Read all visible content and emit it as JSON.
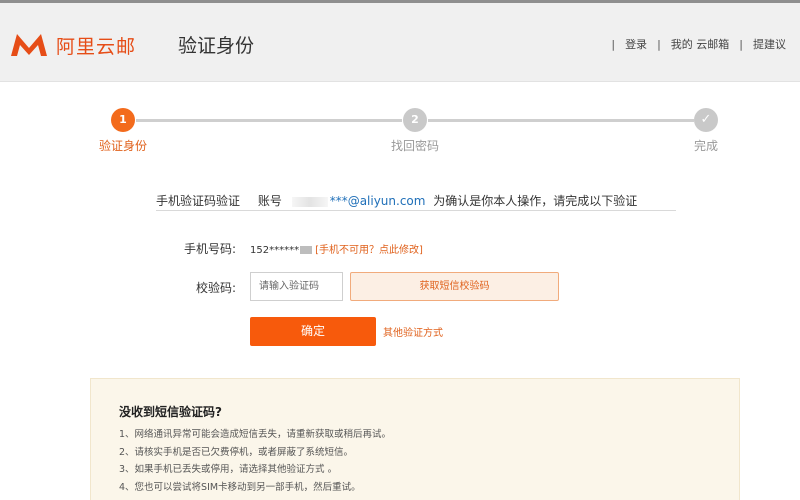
{
  "header": {
    "logo_text": "阿里云邮",
    "page_title": "验证身份",
    "nav": [
      {
        "label": "登录"
      },
      {
        "label": "我的 云邮箱"
      },
      {
        "label": "提建议"
      }
    ]
  },
  "steps": [
    {
      "number": "1",
      "label": "验证身份",
      "state": "active"
    },
    {
      "number": "2",
      "label": "找回密码",
      "state": "pending"
    },
    {
      "number": "✓",
      "label": "完成",
      "state": "pending"
    }
  ],
  "info": {
    "method_label": "手机验证码验证",
    "account_prefix": "账号",
    "account_email": "***@aliyun.com",
    "instruction": "为确认是你本人操作，请完成以下验证"
  },
  "form": {
    "phone_label": "手机号码:",
    "phone_value": "152******",
    "phone_change_link": "[手机不可用？点此修改]",
    "code_label": "校验码:",
    "code_placeholder": "请输入验证码",
    "sms_button": "获取短信校验码",
    "confirm_button": "确定",
    "other_method_link": "其他验证方式"
  },
  "help": {
    "title": "没收到短信验证码?",
    "items": [
      "1、网络通讯异常可能会造成短信丢失，请重新获取或稍后再试。",
      "2、请核实手机是否已欠费停机，或者屏蔽了系统短信。",
      "3、如果手机已丢失或停用，请选择其他验证方式 。",
      "4、您也可以尝试将SIM卡移动到另一部手机，然后重试。"
    ]
  },
  "colors": {
    "accent": "#f36b1c",
    "confirm": "#f75a0c",
    "link": "#e0621d",
    "email": "#1f6fb8",
    "help_bg": "#fbf6ea"
  }
}
